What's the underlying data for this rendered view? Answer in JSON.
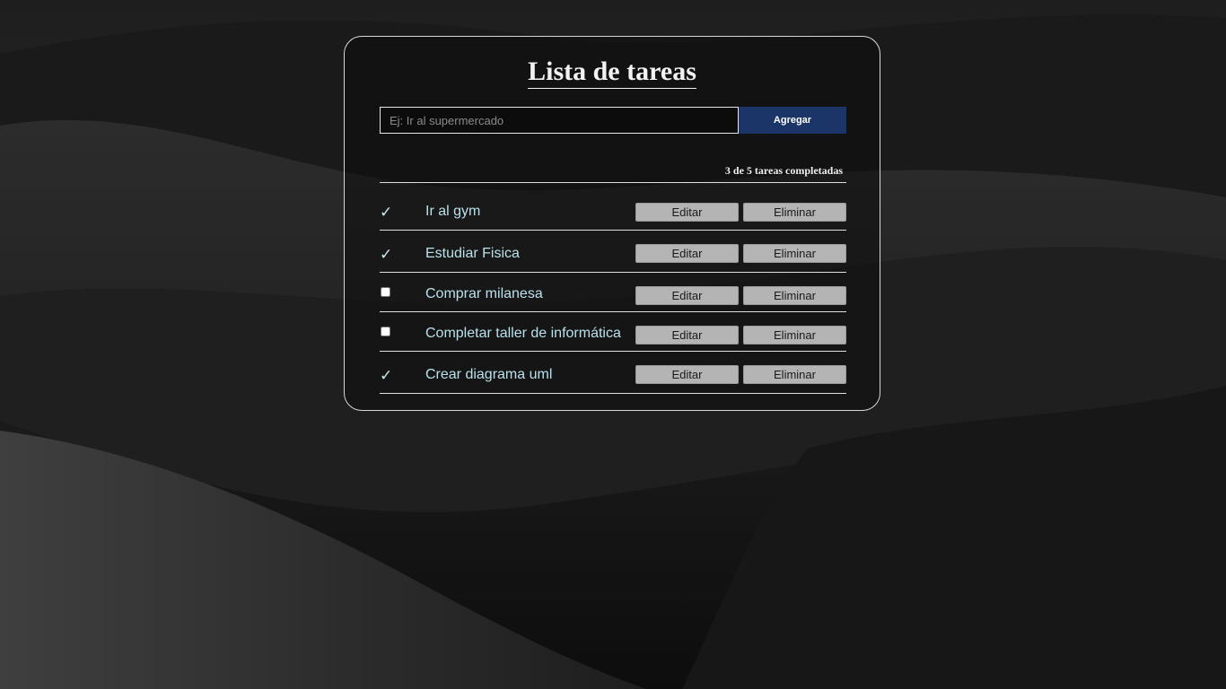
{
  "app": {
    "title": "Lista de tareas",
    "background": "dark-sand-dunes"
  },
  "form": {
    "placeholder": "Ej: Ir al supermercado",
    "value": "",
    "add_label": "Agregar",
    "accent": "#1b3568"
  },
  "counter": {
    "text": "3 de 5 tareas completadas",
    "completed": 3,
    "total": 5
  },
  "tasks": [
    {
      "text": "Ir al gym",
      "done": true,
      "edit_label": "Editar",
      "delete_label": "Eliminar"
    },
    {
      "text": "Estudiar Fisica",
      "done": true,
      "edit_label": "Editar",
      "delete_label": "Eliminar"
    },
    {
      "text": "Comprar milanesa",
      "done": false,
      "edit_label": "Editar",
      "delete_label": "Eliminar"
    },
    {
      "text": "Completar taller de informática",
      "done": false,
      "edit_label": "Editar",
      "delete_label": "Eliminar"
    },
    {
      "text": "Crear diagrama uml",
      "done": true,
      "edit_label": "Editar",
      "delete_label": "Eliminar"
    }
  ],
  "icons": {
    "done": "checkmark-icon",
    "pending": "checkbox"
  },
  "colors": {
    "task_text": "#b9e1ec",
    "button_bg": "#b4b4b4",
    "divider": "#e0e0e0"
  }
}
